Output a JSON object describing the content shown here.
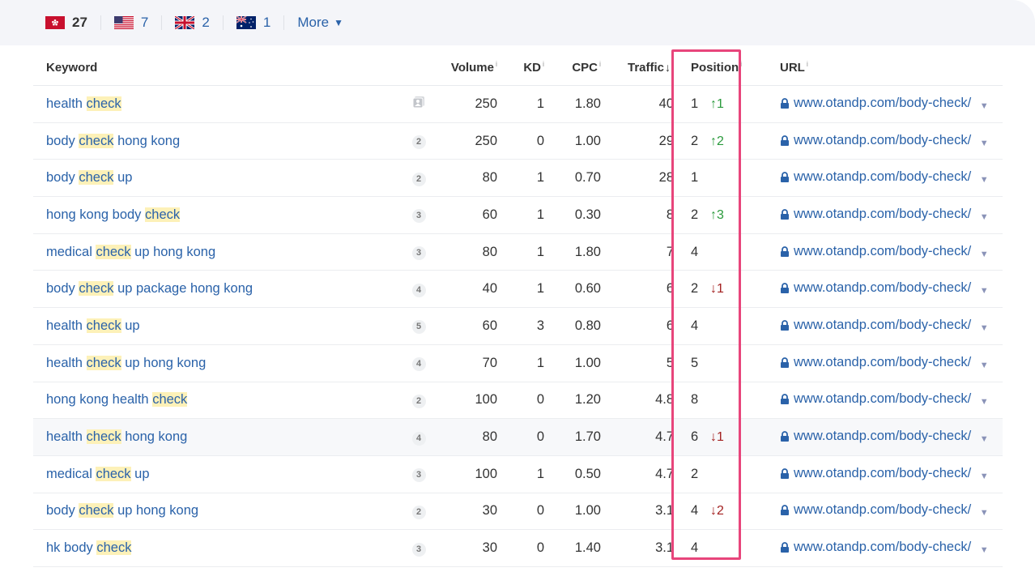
{
  "countries": [
    {
      "code": "HK",
      "count": "27",
      "active": true
    },
    {
      "code": "US",
      "count": "7"
    },
    {
      "code": "GB",
      "count": "2"
    },
    {
      "code": "AU",
      "count": "1"
    }
  ],
  "more_label": "More",
  "columns": {
    "keyword": "Keyword",
    "volume": "Volume",
    "kd": "KD",
    "cpc": "CPC",
    "traffic": "Traffic",
    "position": "Position",
    "url": "URL",
    "info_glyph": "i",
    "sort_glyph": "↓"
  },
  "colors": {
    "link": "#2a62a9",
    "highlight": "#fdf1b8",
    "up": "#2a9a3c",
    "down": "#a32020",
    "box": "#e8457b"
  },
  "rows": [
    {
      "pre": "health ",
      "hl": "check",
      "post": "",
      "serp": "image",
      "volume": "250",
      "kd": "1",
      "cpc": "1.80",
      "traffic": "40",
      "position": "1",
      "change": "↑1",
      "dir": "up",
      "url": "www.otandp.com/body-check/"
    },
    {
      "pre": "body ",
      "hl": "check",
      "post": " hong kong",
      "serp": "2",
      "volume": "250",
      "kd": "0",
      "cpc": "1.00",
      "traffic": "29",
      "position": "2",
      "change": "↑2",
      "dir": "up",
      "url": "www.otandp.com/body-check/"
    },
    {
      "pre": "body ",
      "hl": "check",
      "post": " up",
      "serp": "2",
      "volume": "80",
      "kd": "1",
      "cpc": "0.70",
      "traffic": "28",
      "position": "1",
      "change": "",
      "dir": "",
      "url": "www.otandp.com/body-check/"
    },
    {
      "pre": "hong kong body ",
      "hl": "check",
      "post": "",
      "serp": "3",
      "volume": "60",
      "kd": "1",
      "cpc": "0.30",
      "traffic": "8",
      "position": "2",
      "change": "↑3",
      "dir": "up",
      "url": "www.otandp.com/body-check/"
    },
    {
      "pre": "medical ",
      "hl": "check",
      "post": " up hong kong",
      "serp": "3",
      "volume": "80",
      "kd": "1",
      "cpc": "1.80",
      "traffic": "7",
      "position": "4",
      "change": "",
      "dir": "",
      "url": "www.otandp.com/body-check/"
    },
    {
      "pre": "body ",
      "hl": "check",
      "post": " up package hong kong",
      "serp": "4",
      "volume": "40",
      "kd": "1",
      "cpc": "0.60",
      "traffic": "6",
      "position": "2",
      "change": "↓1",
      "dir": "down",
      "url": "www.otandp.com/body-check/"
    },
    {
      "pre": "health ",
      "hl": "check",
      "post": " up",
      "serp": "5",
      "volume": "60",
      "kd": "3",
      "cpc": "0.80",
      "traffic": "6",
      "position": "4",
      "change": "",
      "dir": "",
      "url": "www.otandp.com/body-check/"
    },
    {
      "pre": "health ",
      "hl": "check",
      "post": " up hong kong",
      "serp": "4",
      "volume": "70",
      "kd": "1",
      "cpc": "1.00",
      "traffic": "5",
      "position": "5",
      "change": "",
      "dir": "",
      "url": "www.otandp.com/body-check/"
    },
    {
      "pre": "hong kong health ",
      "hl": "check",
      "post": "",
      "serp": "2",
      "volume": "100",
      "kd": "0",
      "cpc": "1.20",
      "traffic": "4.8",
      "position": "8",
      "change": "",
      "dir": "",
      "url": "www.otandp.com/body-check/"
    },
    {
      "pre": "health ",
      "hl": "check",
      "post": " hong kong",
      "serp": "4",
      "volume": "80",
      "kd": "0",
      "cpc": "1.70",
      "traffic": "4.7",
      "position": "6",
      "change": "↓1",
      "dir": "down",
      "url": "www.otandp.com/body-check/",
      "hover": true
    },
    {
      "pre": "medical ",
      "hl": "check",
      "post": " up",
      "serp": "3",
      "volume": "100",
      "kd": "1",
      "cpc": "0.50",
      "traffic": "4.7",
      "position": "2",
      "change": "",
      "dir": "",
      "url": "www.otandp.com/body-check/"
    },
    {
      "pre": "body ",
      "hl": "check",
      "post": " up hong kong",
      "serp": "2",
      "volume": "30",
      "kd": "0",
      "cpc": "1.00",
      "traffic": "3.1",
      "position": "4",
      "change": "↓2",
      "dir": "down",
      "url": "www.otandp.com/body-check/"
    },
    {
      "pre": "hk body ",
      "hl": "check",
      "post": "",
      "serp": "3",
      "volume": "30",
      "kd": "0",
      "cpc": "1.40",
      "traffic": "3.1",
      "position": "4",
      "change": "",
      "dir": "",
      "url": "www.otandp.com/body-check/"
    }
  ]
}
